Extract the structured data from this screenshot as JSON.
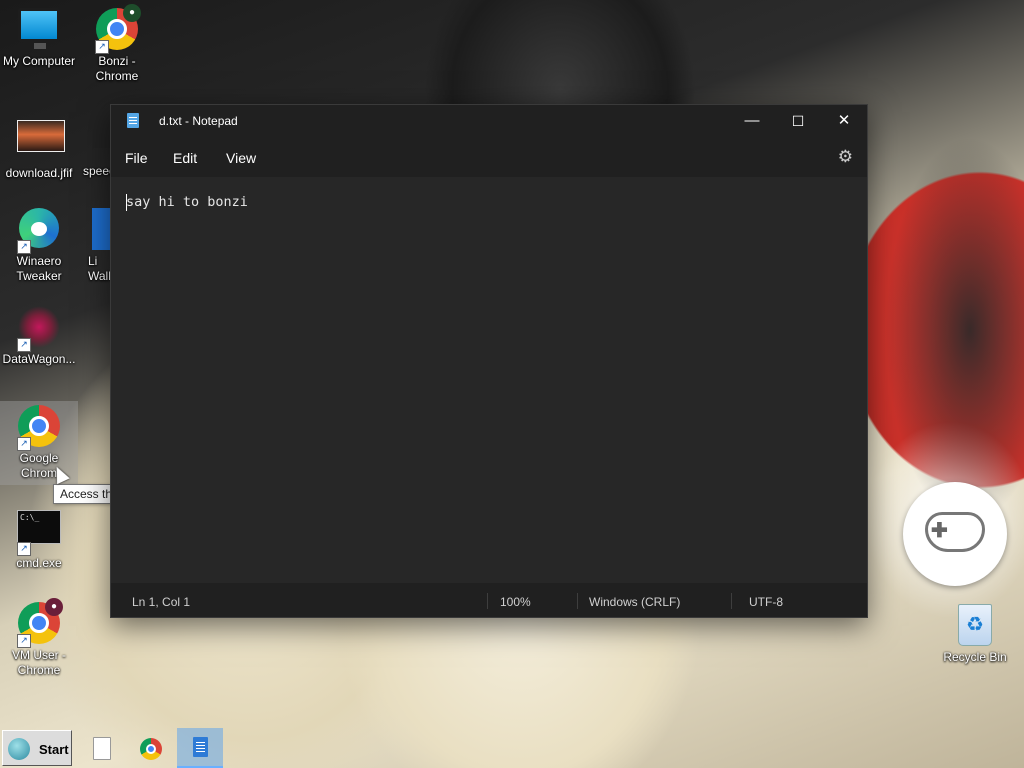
{
  "desktop": {
    "icons": [
      {
        "label": "My Computer"
      },
      {
        "label": "Bonzi -\nChrome"
      },
      {
        "label": "download.jfif"
      },
      {
        "label": "speec"
      },
      {
        "label": "Winaero\nTweaker"
      },
      {
        "label": "Li\nWall"
      },
      {
        "label": "DataWagon..."
      },
      {
        "label": "Google\nChrom"
      },
      {
        "label": "cmd.exe"
      },
      {
        "label": "VM User -\nChrome"
      },
      {
        "label": "Recycle Bin"
      }
    ],
    "tooltip": "Access the Internet",
    "cmd_prompt": "C:\\_"
  },
  "notepad": {
    "title": "d.txt - Notepad",
    "controls": {
      "minimize": "—",
      "maximize": "☐",
      "close": "✕"
    },
    "menu": [
      "File",
      "Edit",
      "View"
    ],
    "content": "say hi to bonzi",
    "status": {
      "position": "Ln 1, Col 1",
      "zoom": "100%",
      "line_ending": "Windows (CRLF)",
      "encoding": "UTF-8"
    }
  },
  "taskbar": {
    "start_label": "Start"
  }
}
